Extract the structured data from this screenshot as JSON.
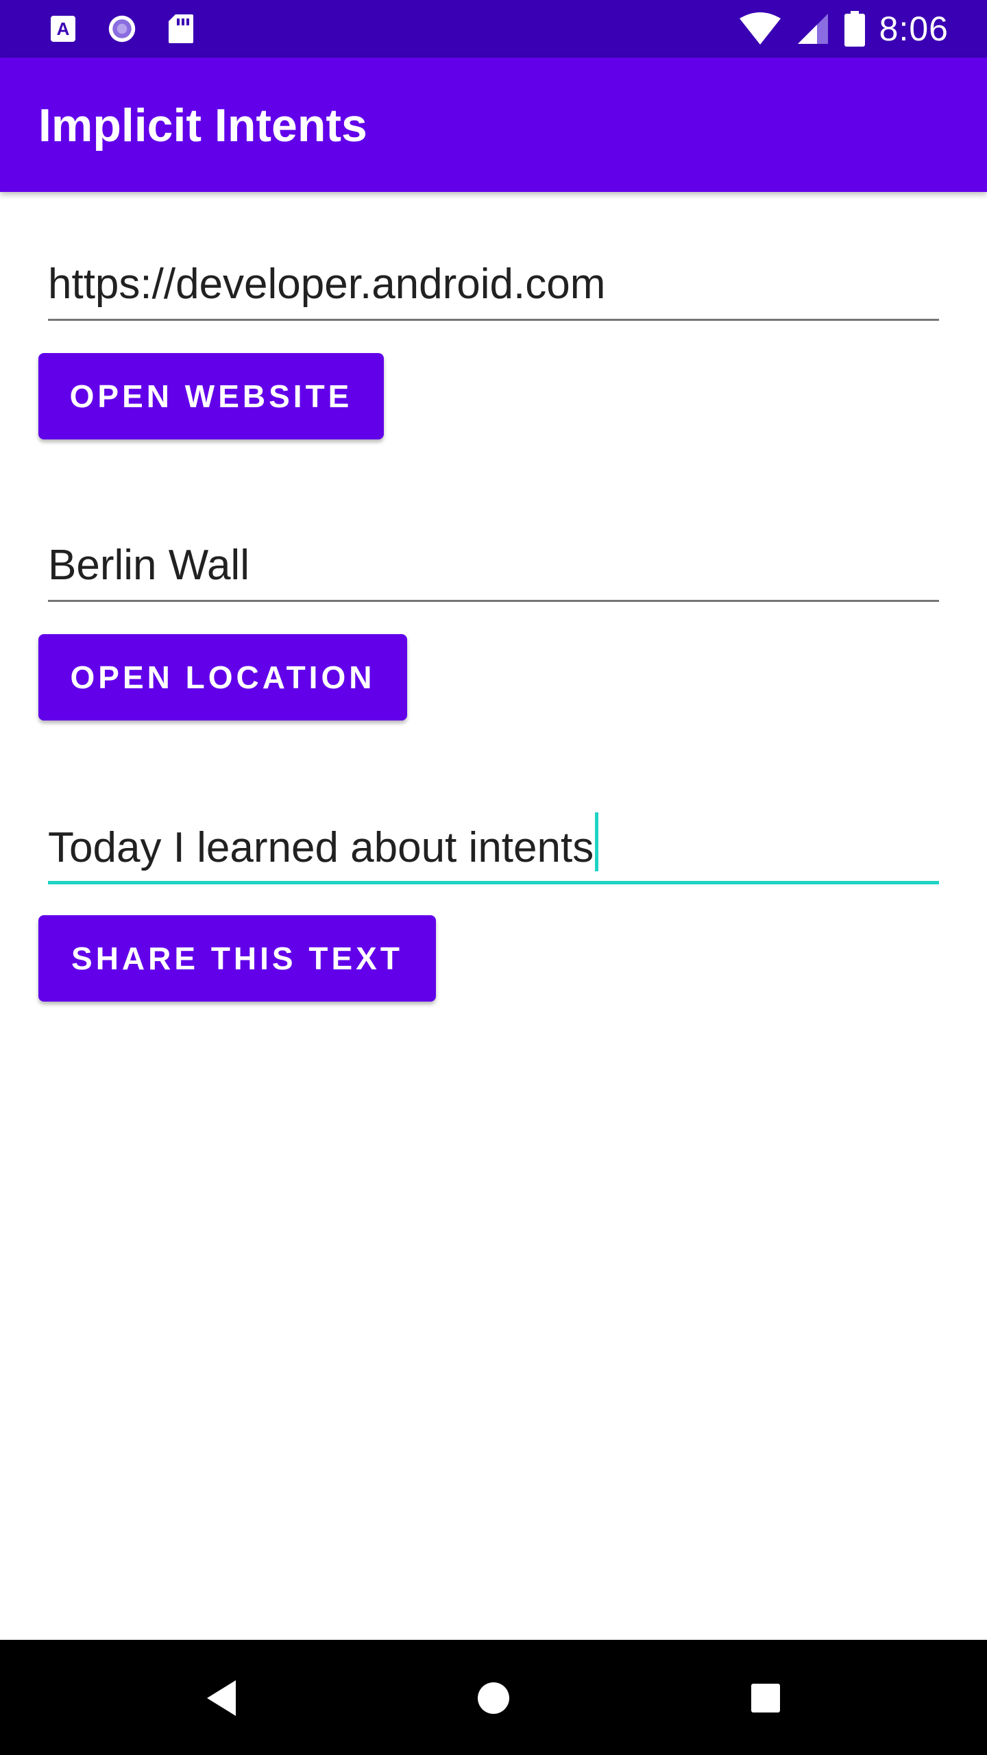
{
  "status_bar": {
    "time": "8:06",
    "left_icons": [
      "text-a-icon",
      "sync-loader-icon",
      "sd-card-icon"
    ],
    "right_icons": [
      "wifi-icon",
      "cell-signal-icon",
      "battery-icon"
    ]
  },
  "app_bar": {
    "title": "Implicit Intents"
  },
  "website": {
    "value": "https://developer.android.com",
    "button_label": "OPEN WEBSITE"
  },
  "location": {
    "value": "Berlin Wall",
    "button_label": "OPEN LOCATION"
  },
  "share": {
    "value": "Today I learned about intents",
    "button_label": "SHARE THIS TEXT"
  },
  "nav_bar": {
    "icons": [
      "back-icon",
      "home-icon",
      "recents-icon"
    ]
  },
  "colors": {
    "status_bar": "#3a00b3",
    "primary": "#6200ea",
    "accent": "#1ed3c4"
  }
}
